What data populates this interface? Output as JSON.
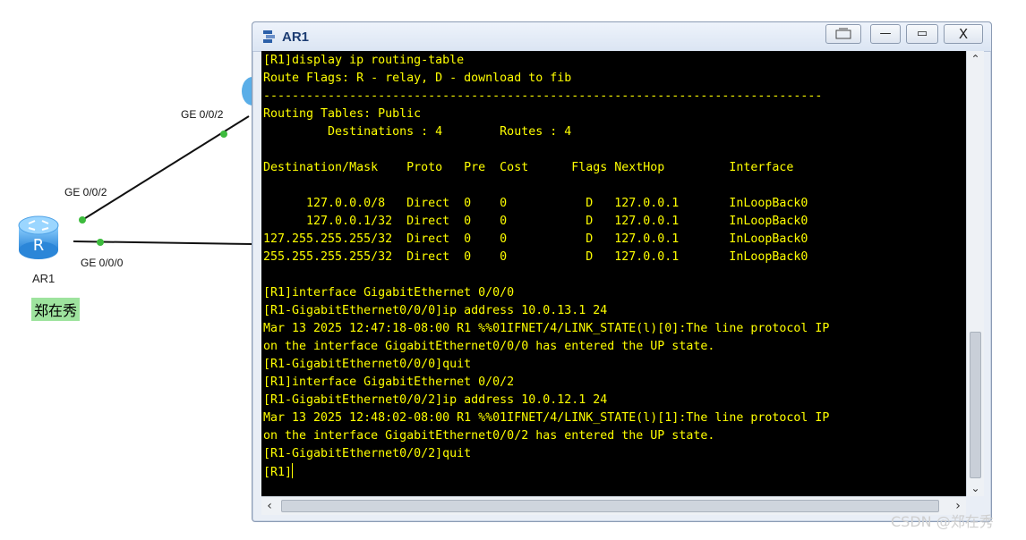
{
  "topology": {
    "ports": {
      "upper_link_port": "GE 0/0/2",
      "router_port_upper": "GE 0/0/2",
      "router_port_lower": "GE 0/0/0"
    },
    "router_name": "AR1",
    "note_text": "郑在秀"
  },
  "window": {
    "title": "AR1",
    "buttons": {
      "minimize": "—",
      "maximize": "▭",
      "close": "X"
    }
  },
  "terminal": {
    "lines": [
      "[R1]display ip routing-table",
      "Route Flags: R - relay, D - download to fib",
      "------------------------------------------------------------------------------",
      "Routing Tables: Public",
      "         Destinations : 4        Routes : 4",
      "",
      "Destination/Mask    Proto   Pre  Cost      Flags NextHop         Interface",
      "",
      "      127.0.0.0/8   Direct  0    0           D   127.0.0.1       InLoopBack0",
      "      127.0.0.1/32  Direct  0    0           D   127.0.0.1       InLoopBack0",
      "127.255.255.255/32  Direct  0    0           D   127.0.0.1       InLoopBack0",
      "255.255.255.255/32  Direct  0    0           D   127.0.0.1       InLoopBack0",
      "",
      "[R1]interface GigabitEthernet 0/0/0",
      "[R1-GigabitEthernet0/0/0]ip address 10.0.13.1 24",
      "Mar 13 2025 12:47:18-08:00 R1 %%01IFNET/4/LINK_STATE(l)[0]:The line protocol IP",
      "on the interface GigabitEthernet0/0/0 has entered the UP state.",
      "[R1-GigabitEthernet0/0/0]quit",
      "[R1]interface GigabitEthernet 0/0/2",
      "[R1-GigabitEthernet0/0/2]ip address 10.0.12.1 24",
      "Mar 13 2025 12:48:02-08:00 R1 %%01IFNET/4/LINK_STATE(l)[1]:The line protocol IP",
      "on the interface GigabitEthernet0/0/2 has entered the UP state.",
      "[R1-GigabitEthernet0/0/2]quit",
      "[R1]"
    ]
  },
  "watermark": "CSDN @郑在秀"
}
